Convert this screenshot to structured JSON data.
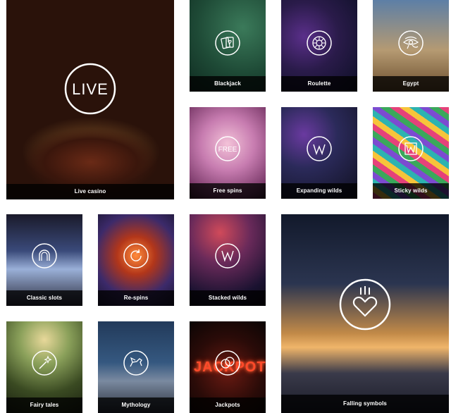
{
  "tiles": {
    "live": {
      "label": "Live casino",
      "icon": "live-icon"
    },
    "blackjack": {
      "label": "Blackjack",
      "icon": "cards-icon"
    },
    "roulette": {
      "label": "Roulette",
      "icon": "roulette-wheel-icon"
    },
    "egypt": {
      "label": "Egypt",
      "icon": "eye-of-horus-icon"
    },
    "free": {
      "label": "Free spins",
      "icon": "free-icon"
    },
    "expanding": {
      "label": "Expanding wilds",
      "icon": "w-icon"
    },
    "sticky": {
      "label": "Sticky wilds",
      "icon": "sticky-w-icon"
    },
    "classic": {
      "label": "Classic slots",
      "icon": "horseshoe-icon"
    },
    "respins": {
      "label": "Re-spins",
      "icon": "respin-icon"
    },
    "stacked": {
      "label": "Stacked wilds",
      "icon": "stacked-w-icon"
    },
    "falling": {
      "label": "Falling symbols",
      "icon": "falling-heart-icon"
    },
    "fairy": {
      "label": "Fairy tales",
      "icon": "magic-wand-icon"
    },
    "myth": {
      "label": "Mythology",
      "icon": "pegasus-icon"
    },
    "jackpots": {
      "label": "Jackpots",
      "icon": "coins-icon",
      "neon_text": "JACKPOT"
    }
  },
  "live_icon_text": "LIVE",
  "free_icon_text": "FREE",
  "wild_letter": "W"
}
